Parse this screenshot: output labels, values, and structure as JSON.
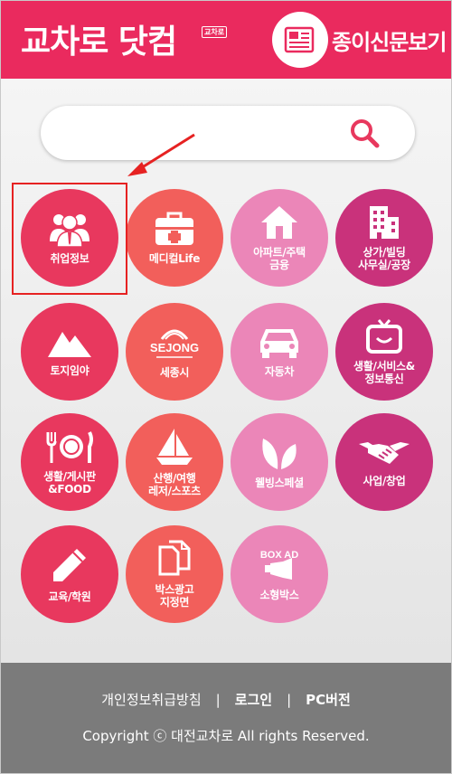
{
  "header": {
    "logo_text": "교차로 닷컴",
    "logo_badge": "교차로",
    "paper_label": "종이신문보기",
    "brand_color": "#ea2a5e"
  },
  "search": {
    "placeholder": "",
    "icon": "search-icon"
  },
  "categories": [
    {
      "label": "취업정보",
      "icon": "people-icon"
    },
    {
      "label": "메디컬Life",
      "icon": "medkit-icon"
    },
    {
      "label": "아파트/주택\n금융",
      "icon": "house-icon"
    },
    {
      "label": "상가/빌딩\n사무실/공장",
      "icon": "building-icon"
    },
    {
      "label": "토지임야",
      "icon": "mountain-icon"
    },
    {
      "label": "세종시",
      "icon": "sejong-logo-icon",
      "logo_text": "SEJONG"
    },
    {
      "label": "자동차",
      "icon": "car-icon"
    },
    {
      "label": "생활/서비스&\n정보통신",
      "icon": "tv-icon"
    },
    {
      "label": "생활/게시판\n&FOOD",
      "icon": "dining-icon"
    },
    {
      "label": "산행/여행\n레저/스포츠",
      "icon": "sailboat-icon"
    },
    {
      "label": "웰빙스페셜",
      "icon": "leaves-icon"
    },
    {
      "label": "사업/창업",
      "icon": "handshake-icon"
    },
    {
      "label": "교육/학원",
      "icon": "pencil-icon"
    },
    {
      "label": "박스광고\n지정면",
      "icon": "documents-icon"
    },
    {
      "label": "소형박스",
      "icon": "box-ad-icon",
      "logo_text": "BOX AD"
    }
  ],
  "footer": {
    "privacy": "개인정보취급방침",
    "login": "로그인",
    "pc": "PC버전",
    "separator": "|",
    "copyright": "Copyright ⓒ 대전교차로 All rights Reserved."
  },
  "colors": {
    "red": "#e8385e",
    "coral": "#f25f5b",
    "pink": "#eb86b8",
    "magenta": "#c9327b",
    "footer": "#7b7b7b"
  }
}
